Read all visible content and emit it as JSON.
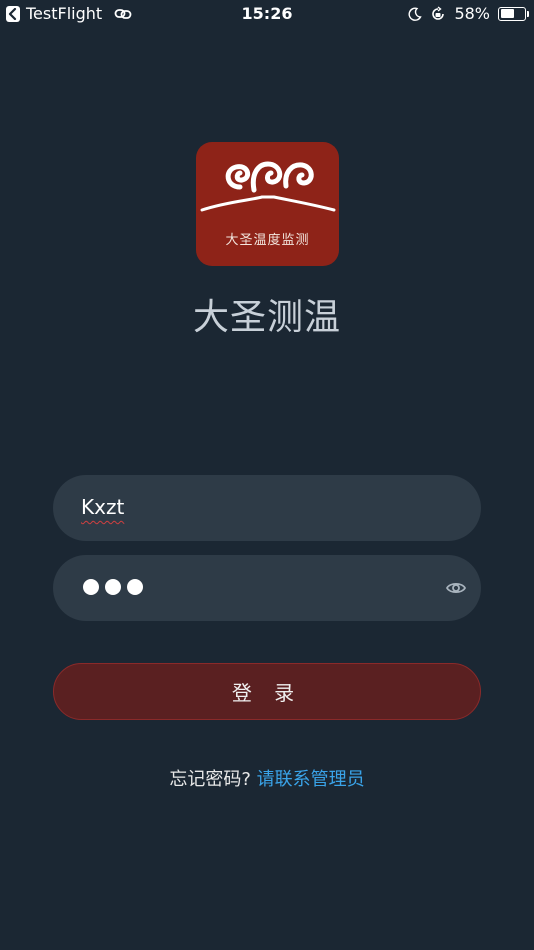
{
  "status_bar": {
    "back_app": "TestFlight",
    "time": "15:26",
    "battery_percent": "58%",
    "battery_level": 0.58,
    "icons": [
      "back-arrow-icon",
      "link-icon",
      "moon-icon",
      "rotation-lock-icon",
      "battery-icon"
    ]
  },
  "logo": {
    "caption": "大圣温度监测",
    "background_color": "#8e2318"
  },
  "app": {
    "title": "大圣测温"
  },
  "login": {
    "username_value": "Kxzt",
    "password_masked_count": 3,
    "eye_icon": "eye-icon",
    "submit_label": "登 录",
    "forgot_text": "忘记密码?",
    "contact_link": "请联系管理员",
    "colors": {
      "background": "#1b2733",
      "field": "#2e3b47",
      "button": "#5a2021",
      "link": "#3aa3e8"
    }
  }
}
